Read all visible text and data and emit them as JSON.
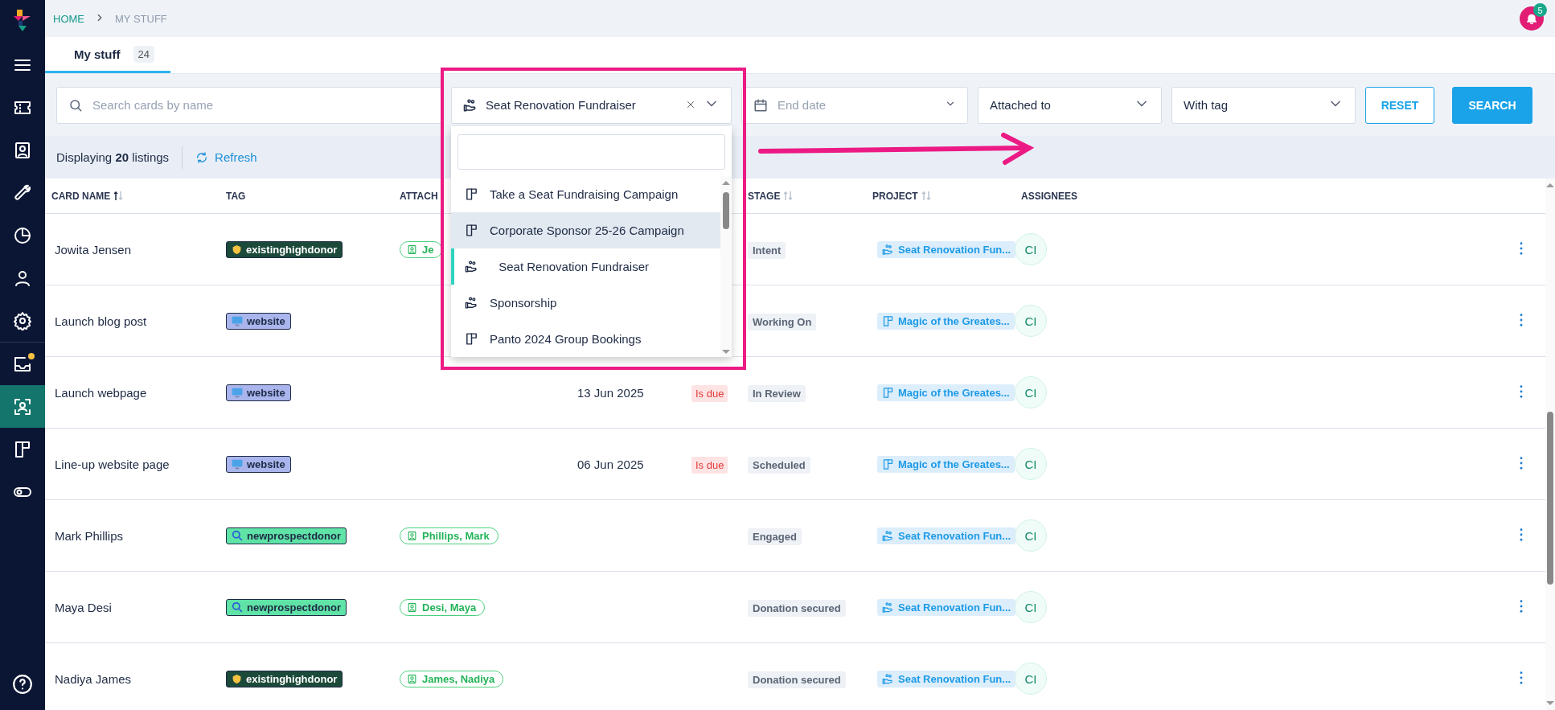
{
  "sidebar": {
    "items": [
      {
        "selected": false,
        "badge": false
      },
      {
        "selected": false,
        "badge": false
      },
      {
        "selected": false,
        "badge": false
      },
      {
        "selected": false,
        "badge": false
      },
      {
        "selected": false,
        "badge": false
      },
      {
        "selected": false,
        "badge": false
      },
      {
        "selected": false,
        "badge": false
      },
      {
        "selected": false,
        "badge": true
      },
      {
        "selected": true,
        "badge": false
      },
      {
        "selected": false,
        "badge": false
      },
      {
        "selected": false,
        "badge": false
      }
    ]
  },
  "breadcrumb": [
    "HOME",
    "MY STUFF"
  ],
  "notifications": {
    "count": "5"
  },
  "tabs": [
    {
      "label": "My stuff",
      "count": "24",
      "selected": true
    }
  ],
  "filters": {
    "search": {
      "placeholder": "Search cards by name"
    },
    "project": {
      "value": "Seat Renovation Fundraiser",
      "kind": "campaign",
      "options": [
        {
          "label": "Take a Seat Fundraising Campaign",
          "kind": "board",
          "highlighted": false,
          "selected": false
        },
        {
          "label": "Corporate Sponsor 25-26 Campaign",
          "kind": "board",
          "highlighted": true,
          "selected": false
        },
        {
          "label": "Seat Renovation Fundraiser",
          "kind": "campaign",
          "highlighted": false,
          "selected": true
        },
        {
          "label": "Sponsorship",
          "kind": "campaign",
          "highlighted": false,
          "selected": false
        },
        {
          "label": "Panto 2024 Group Bookings",
          "kind": "board",
          "highlighted": false,
          "selected": false
        }
      ]
    },
    "end_date": {
      "placeholder": "End date"
    },
    "attached_to": {
      "value": "Attached to"
    },
    "with_tag": {
      "value": "With tag"
    },
    "buttons": [
      "RESET",
      "SEARCH"
    ]
  },
  "listing": {
    "summary": "Displaying **20** listings",
    "refresh": "Refresh"
  },
  "table": {
    "columns": [
      {
        "label": "CARD NAME",
        "sortable": true,
        "sorted": true
      },
      {
        "label": "TAG",
        "sortable": false
      },
      {
        "label": "ATTACH",
        "sortable": false
      },
      {
        "label": "STAGE",
        "sortable": true,
        "sorted": false
      },
      {
        "label": "PROJECT",
        "sortable": true,
        "sorted": false
      },
      {
        "label": "ASSIGNEES",
        "sortable": false
      }
    ],
    "rows": [
      {
        "name": "Jowita Jensen",
        "tag": {
          "label": "existinghighdonor",
          "kind": "donor",
          "color": "#1c4a3a"
        },
        "attached": "Je",
        "stage": "Intent",
        "project": {
          "label": "Seat Renovation Fun...",
          "kind": "campaign"
        },
        "assignee": "CI"
      },
      {
        "name": "Launch blog post",
        "tag": {
          "label": "website",
          "kind": "website",
          "color": "#a9b5ec"
        },
        "stage": "Working On",
        "project": {
          "label": "Magic of the Greates...",
          "kind": "board"
        },
        "assignee": "CI"
      },
      {
        "name": "Launch webpage",
        "tag": {
          "label": "website",
          "kind": "website",
          "color": "#a9b5ec"
        },
        "date": "13 Jun 2025",
        "due": "Is due",
        "stage": "In Review",
        "project": {
          "label": "Magic of the Greates...",
          "kind": "board"
        },
        "assignee": "CI"
      },
      {
        "name": "Line-up website page",
        "tag": {
          "label": "website",
          "kind": "website",
          "color": "#a9b5ec"
        },
        "date": "06 Jun 2025",
        "due": "Is due",
        "stage": "Scheduled",
        "project": {
          "label": "Magic of the Greates...",
          "kind": "board"
        },
        "assignee": "CI"
      },
      {
        "name": "Mark Phillips",
        "tag": {
          "label": "newprospectdonor",
          "kind": "prospect",
          "color": "#5fe3a6"
        },
        "attached": "Phillips, Mark",
        "stage": "Engaged",
        "project": {
          "label": "Seat Renovation Fun...",
          "kind": "campaign"
        },
        "assignee": "CI"
      },
      {
        "name": "Maya Desi",
        "tag": {
          "label": "newprospectdonor",
          "kind": "prospect",
          "color": "#5fe3a6"
        },
        "attached": "Desi, Maya",
        "stage": "Donation secured",
        "project": {
          "label": "Seat Renovation Fun...",
          "kind": "campaign"
        },
        "assignee": "CI"
      },
      {
        "name": "Nadiya James",
        "tag": {
          "label": "existinghighdonor",
          "kind": "donor",
          "color": "#1c4a3a"
        },
        "attached": "James, Nadiya",
        "stage": "Donation secured",
        "project": {
          "label": "Seat Renovation Fun...",
          "kind": "campaign"
        },
        "assignee": "CI"
      }
    ]
  }
}
